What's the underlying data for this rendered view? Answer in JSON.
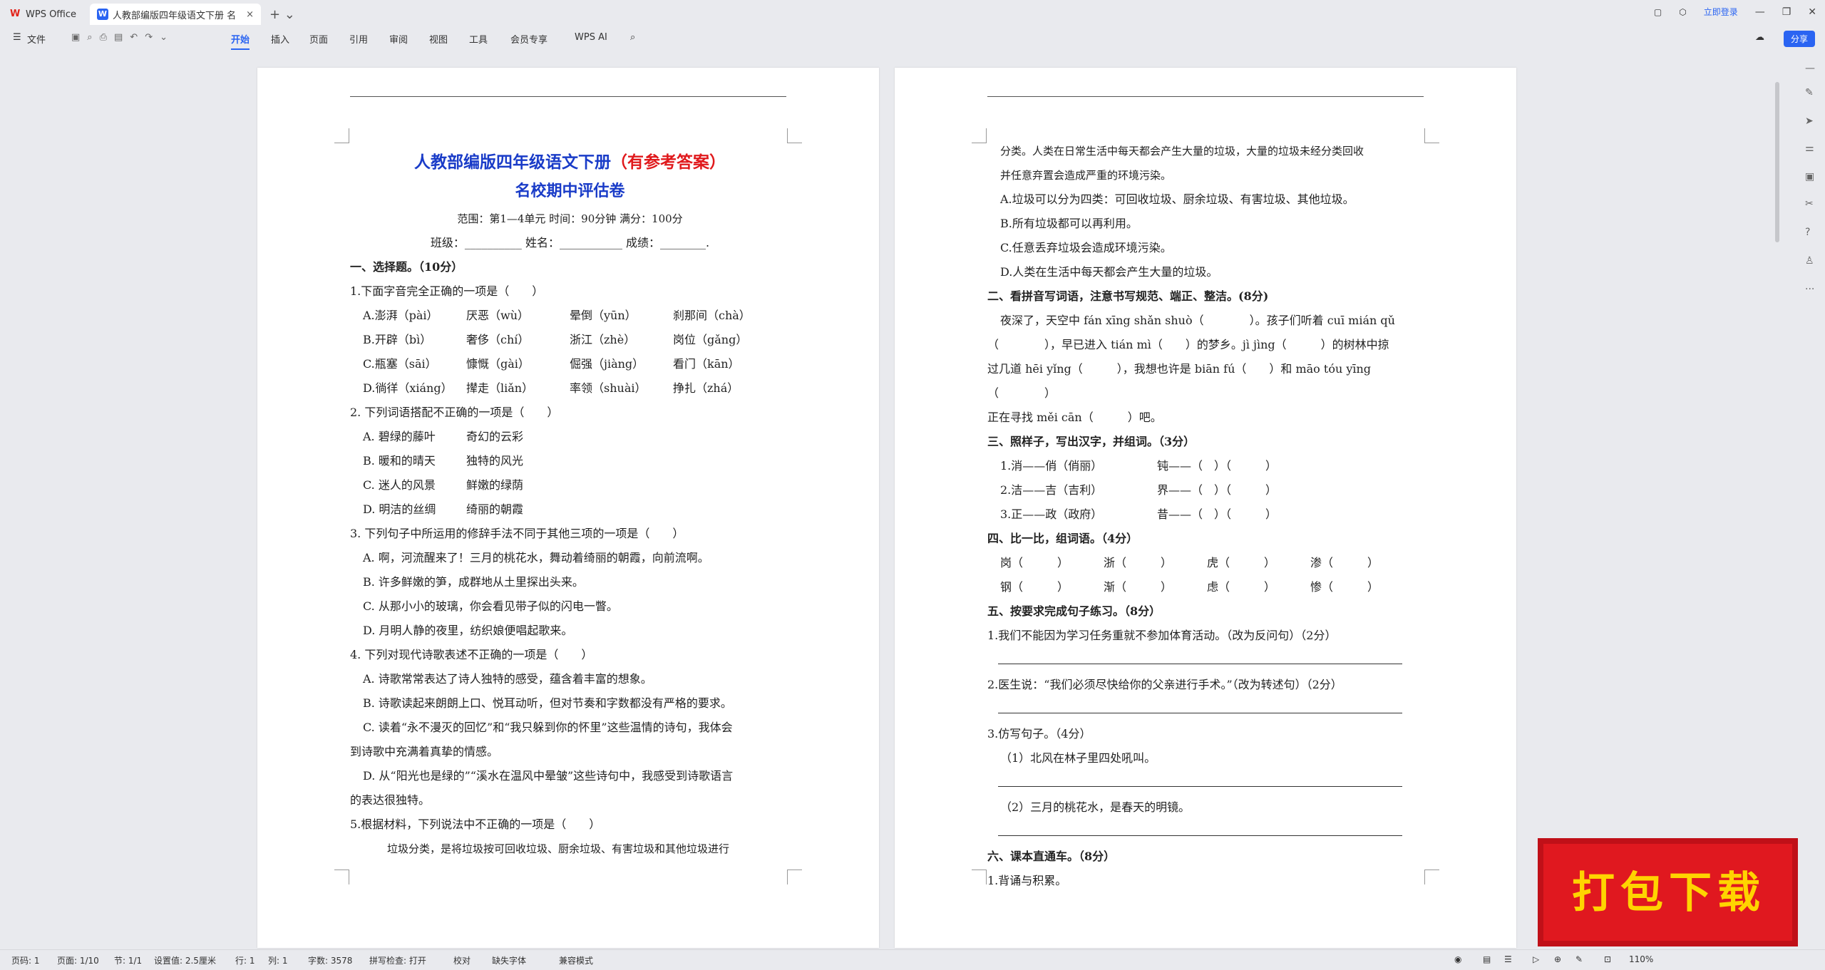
{
  "tabs": {
    "wps_office": "WPS Office",
    "doc_title": "人教部编版四年级语文下册 名",
    "login": "立即登录"
  },
  "ribbon": {
    "file": "文件",
    "items": [
      "开始",
      "插入",
      "页面",
      "引用",
      "审阅",
      "视图",
      "工具",
      "会员专享"
    ],
    "wps_ai": "WPS AI",
    "share": "分享"
  },
  "page1": {
    "title_blue": "人教部编版四年级语文下册",
    "title_red": "（有参考答案）",
    "subtitle": "名校期中评估卷",
    "scope": "范围：第1—4单元   时间：90分钟   满分：100分",
    "fill": "班级：__________  姓名：___________  成绩：________.",
    "sec1": "一、选择题。（10分）",
    "q1": "1.下面字音完全正确的一项是（　　）",
    "q1a": [
      "A.澎湃（pài）",
      "厌恶（wù）",
      "晕倒（yūn）",
      "刹那间（chà）"
    ],
    "q1b": [
      "B.开辟（bì）",
      "奢侈（chí）",
      "浙江（zhè）",
      "岗位（gǎng）"
    ],
    "q1c": [
      "C.瓶塞（sāi）",
      "慷慨（gài）",
      "倔强（jiàng）",
      "看门（kān）"
    ],
    "q1d": [
      "D.徜徉（xiáng）",
      "撵走（liǎn）",
      "率领（shuài）",
      "挣扎（zhá）"
    ],
    "q2": "2. 下列词语搭配不正确的一项是（　　）",
    "q2a": [
      "A. 碧绿的藤叶",
      "奇幻的云彩"
    ],
    "q2b": [
      "B. 暖和的晴天",
      "独特的风光"
    ],
    "q2c": [
      "C. 迷人的风景",
      "鲜嫩的绿荫"
    ],
    "q2d": [
      "D. 明洁的丝绸",
      "绮丽的朝霞"
    ],
    "q3": "3. 下列句子中所运用的修辞手法不同于其他三项的一项是（　　）",
    "q3a": "A. 啊，河流醒来了！三月的桃花水，舞动着绮丽的朝霞，向前流啊。",
    "q3b": "B. 许多鲜嫩的笋，成群地从土里探出头来。",
    "q3c": "C. 从那小小的玻璃，你会看见带子似的闪电一瞥。",
    "q3d": "D. 月明人静的夜里，纺织娘便唱起歌来。",
    "q4": "4. 下列对现代诗歌表述不正确的一项是（　　）",
    "q4a": "A. 诗歌常常表达了诗人独特的感受，蕴含着丰富的想象。",
    "q4b": "B. 诗歌读起来朗朗上口、悦耳动听，但对节奏和字数都没有严格的要求。",
    "q4c1": "C. 读着“永不漫灭的回忆”和“我只躲到你的怀里”这些温情的诗句，我体会",
    "q4c2": "到诗歌中充满着真挚的情感。",
    "q4d1": "D. 从“阳光也是绿的”“溪水在温风中晕皱”这些诗句中，我感受到诗歌语言",
    "q4d2": "的表达很独特。",
    "q5": "5.根据材料，下列说法中不正确的一项是（　　）",
    "q5m": "垃圾分类，是将垃圾按可回收垃圾、厨余垃圾、有害垃圾和其他垃圾进行"
  },
  "page2": {
    "p1": "分类。人类在日常生活中每天都会产生大量的垃圾，大量的垃圾未经分类回收",
    "p2": "并任意弃置会造成严重的环境污染。",
    "a": "A.垃圾可以分为四类：可回收垃圾、厨余垃圾、有害垃圾、其他垃圾。",
    "b": "B.所有垃圾都可以再利用。",
    "c": "C.任意丢弃垃圾会造成环境污染。",
    "d": "D.人类在生活中每天都会产生大量的垃圾。",
    "sec2": "二、看拼音写词语，注意书写规范、端正、整洁。(8分)",
    "py1": "夜深了，天空中 fán xīng shǎn shuò（　　　　）。孩子们听着 cuī mián qǔ",
    "py2": "（　　　　），早已进入 tián mì（　　）的梦乡。jì jìng（　　　）的树林中掠",
    "py3": "过几道 hēi yǐng（　　　），我想也许是 biān fú（　　）和 māo tóu yīng（　　　　）",
    "py4": "正在寻找 měi cān（　　　）吧。",
    "sec3": "三、照样子，写出汉字，并组词。（3分）",
    "s3": [
      [
        "1.消——俏（俏丽）",
        "钝——（　）（　　　）"
      ],
      [
        "2.洁——吉（吉利）",
        "界——（　）（　　　）"
      ],
      [
        "3.正——政（政府）",
        "昔——（　）（　　　）"
      ]
    ],
    "sec4": "四、比一比，组词语。（4分）",
    "s4a": [
      "岗（　　　）",
      "浙（　　　）",
      "虎（　　　）",
      "渗（　　　）"
    ],
    "s4b": [
      "钢（　　　）",
      "渐（　　　）",
      "虑（　　　）",
      "惨（　　　）"
    ],
    "sec5": "五、按要求完成句子练习。（8分）",
    "s5q1": "1.我们不能因为学习任务重就不参加体育活动。（改为反问句）（2分）",
    "s5q2": "2.医生说：“我们必须尽快给你的父亲进行手术。”（改为转述句）（2分）",
    "s5q3": "3.仿写句子。（4分）",
    "s5q3a": "（1）北风在林子里四处吼叫。",
    "s5q3b": "（2）三月的桃花水，是春天的明镜。",
    "sec6": "六、课本直通车。（8分）",
    "s6q1": "1.背诵与积累。"
  },
  "status": {
    "page": "页码: 1",
    "pages": "页面: 1/10",
    "section": "节: 1/1",
    "setting": "设置值: 2.5厘米",
    "row": "行: 1",
    "col": "列: 1",
    "words": "字数: 3578",
    "spell": "拼写检查: 打开",
    "proof": "校对",
    "missing_font": "缺失字体",
    "compat": "兼容模式",
    "zoom": "110%"
  },
  "overlay": {
    "download": "打包下载"
  },
  "colors": {
    "accent": "#2a64f2",
    "title_blue": "#1a3cc8",
    "title_red": "#e0191c"
  }
}
